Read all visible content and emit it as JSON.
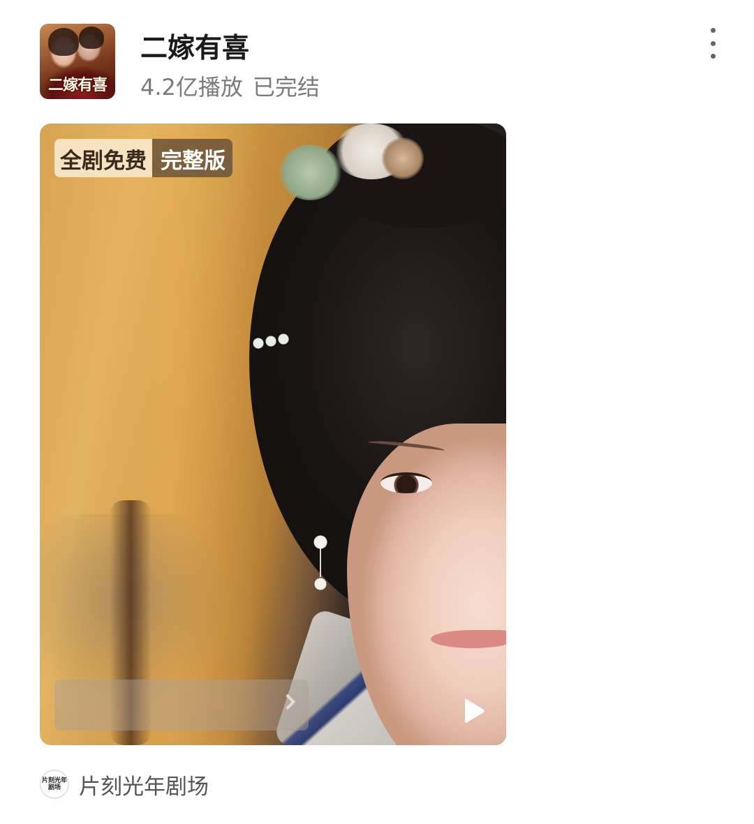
{
  "header": {
    "thumbnail_logo_text": "二嫁有喜",
    "title": "二嫁有喜",
    "play_count": "4.2亿播放",
    "status": "已完结",
    "more_icon": "more-vertical-icon"
  },
  "video": {
    "badge_left": "全剧免费",
    "badge_right": "完整版",
    "bottom_bar_text": "",
    "bottom_bar_icon": "chevron-right-icon",
    "play_icon": "play-icon"
  },
  "source": {
    "avatar_lines": [
      "片刻光年",
      "剧场"
    ],
    "name": "片刻光年剧场"
  },
  "colors": {
    "badge_left_bg": "#f7e2c2",
    "badge_right_bg": "#6e563a",
    "title": "#1a1a1a",
    "subtitle": "#7a7a7a"
  }
}
